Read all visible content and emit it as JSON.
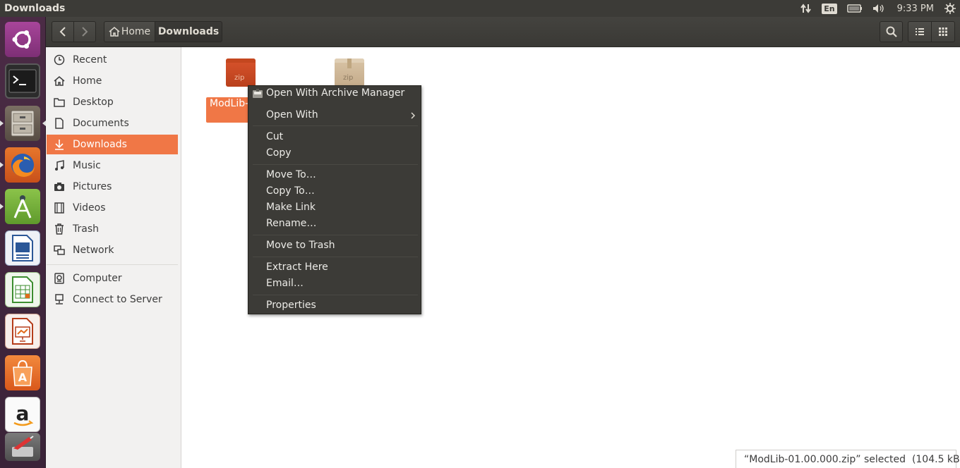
{
  "window": {
    "title": "Downloads"
  },
  "indicators": {
    "keyboard": "En",
    "clock": "9:33 PM"
  },
  "launcher": {
    "items": [
      {
        "name": "ubuntu-dash",
        "icon": "ubuntu-logo-icon"
      },
      {
        "name": "terminal",
        "icon": "terminal-icon"
      },
      {
        "name": "files",
        "icon": "file-cabinet-icon"
      },
      {
        "name": "firefox",
        "icon": "firefox-icon"
      },
      {
        "name": "android-studio",
        "icon": "android-studio-icon"
      },
      {
        "name": "libreoffice-writer",
        "icon": "writer-icon"
      },
      {
        "name": "libreoffice-calc",
        "icon": "calc-icon"
      },
      {
        "name": "libreoffice-impress",
        "icon": "impress-icon"
      },
      {
        "name": "software-center",
        "icon": "shopping-bag-icon"
      },
      {
        "name": "amazon",
        "icon": "amazon-icon"
      },
      {
        "name": "system-settings",
        "icon": "settings-tools-icon"
      }
    ]
  },
  "breadcrumb": {
    "home": "Home",
    "current": "Downloads"
  },
  "sidebar": {
    "items": [
      {
        "label": "Recent",
        "icon": "clock-icon"
      },
      {
        "label": "Home",
        "icon": "home-icon"
      },
      {
        "label": "Desktop",
        "icon": "folder-icon"
      },
      {
        "label": "Documents",
        "icon": "document-icon"
      },
      {
        "label": "Downloads",
        "icon": "download-arrow-icon",
        "active": true
      },
      {
        "label": "Music",
        "icon": "music-note-icon"
      },
      {
        "label": "Pictures",
        "icon": "camera-icon"
      },
      {
        "label": "Videos",
        "icon": "film-icon"
      },
      {
        "label": "Trash",
        "icon": "trash-icon"
      },
      {
        "label": "Network",
        "icon": "network-icon"
      },
      {
        "label": "Computer",
        "icon": "computer-icon"
      },
      {
        "label": "Connect to Server",
        "icon": "server-icon"
      }
    ]
  },
  "files": [
    {
      "label_line1": "ModLib-01",
      "label_line2": "zip",
      "badge": "zip",
      "selected": true
    },
    {
      "badge": "zip",
      "selected": false
    }
  ],
  "context_menu": {
    "items": [
      "Open With Archive Manager",
      "Open With",
      "Cut",
      "Copy",
      "Move To…",
      "Copy To…",
      "Make Link",
      "Rename…",
      "Move to Trash",
      "Extract Here",
      "Email…",
      "Properties"
    ]
  },
  "status": {
    "text": "“ModLib-01.00.000.zip” selected  (104.5 kB)"
  },
  "colors": {
    "accent": "#f07746",
    "panel": "#3c3b37",
    "launcher": "#4b2b45"
  }
}
